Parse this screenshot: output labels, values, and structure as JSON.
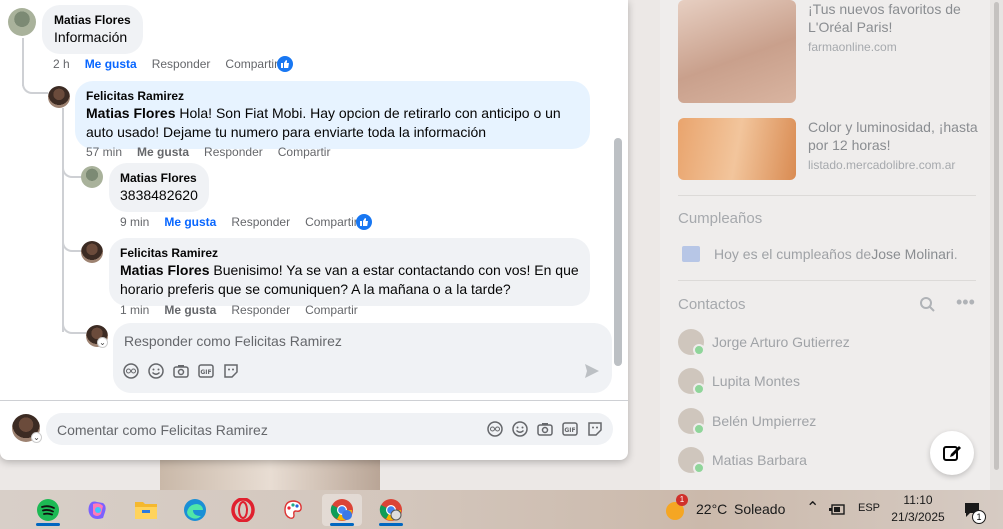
{
  "comments": {
    "c1": {
      "author": "Matias Flores",
      "text": "Información",
      "time": "2 h",
      "like": "Me gusta",
      "reply": "Responder",
      "share": "Compartir"
    },
    "c2": {
      "author": "Felicitas Ramirez",
      "mention": "Matias Flores",
      "text": " Hola! Son Fiat Mobi. Hay opcion de retirarlo con anticipo o un auto usado! Dejame tu numero para enviarte toda la información",
      "time": "57 min",
      "like": "Me gusta",
      "reply": "Responder",
      "share": "Compartir"
    },
    "c3": {
      "author": "Matias Flores",
      "text": "3838482620",
      "time": "9 min",
      "like": "Me gusta",
      "reply": "Responder",
      "share": "Compartir"
    },
    "c4": {
      "author": "Felicitas Ramirez",
      "mention": "Matias Flores",
      "text": " Buenisimo! Ya se van a estar contactando con vos! En que horario preferis que se comuniquen? A la mañana o a la tarde?",
      "time": "1 min",
      "like": "Me gusta",
      "reply": "Responder",
      "share": "Compartir"
    }
  },
  "reply_box": {
    "placeholder": "Responder como Felicitas Ramirez"
  },
  "comment_box": {
    "placeholder": "Comentar como Felicitas Ramirez"
  },
  "sidebar": {
    "ads": [
      {
        "title": "¡Tus nuevos favoritos de L'Oréal Paris!",
        "source": "farmaonline.com"
      },
      {
        "title": "Color y luminosidad, ¡hasta por 12 horas!",
        "source": "listado.mercadolibre.com.ar"
      }
    ],
    "birthdays_title": "Cumpleaños",
    "birthday_text": "Hoy es el cumpleaños de ",
    "birthday_name": "Jose Molinari",
    "birthday_end": ".",
    "contacts_title": "Contactos",
    "contacts": [
      "Jorge Arturo Gutierrez",
      "Lupita Montes",
      "Belén Umpierrez",
      "Matias Barbara"
    ]
  },
  "taskbar": {
    "apps": [
      "spotify-icon",
      "copilot-icon",
      "file-explorer-icon",
      "edge-icon",
      "opera-icon",
      "paint-icon",
      "chrome-icon",
      "chrome-profile-icon"
    ],
    "weather_temp": "22°C",
    "weather_desc": "Soleado",
    "weather_badge": "1",
    "language": "ESP",
    "time": "11:10",
    "date": "21/3/2025",
    "notifications": "1"
  },
  "colors": {
    "link_blue": "#0866ff",
    "bubble_gray": "#f0f2f5",
    "bubble_blue": "#e7f3ff",
    "like_badge": "#1877f2"
  }
}
